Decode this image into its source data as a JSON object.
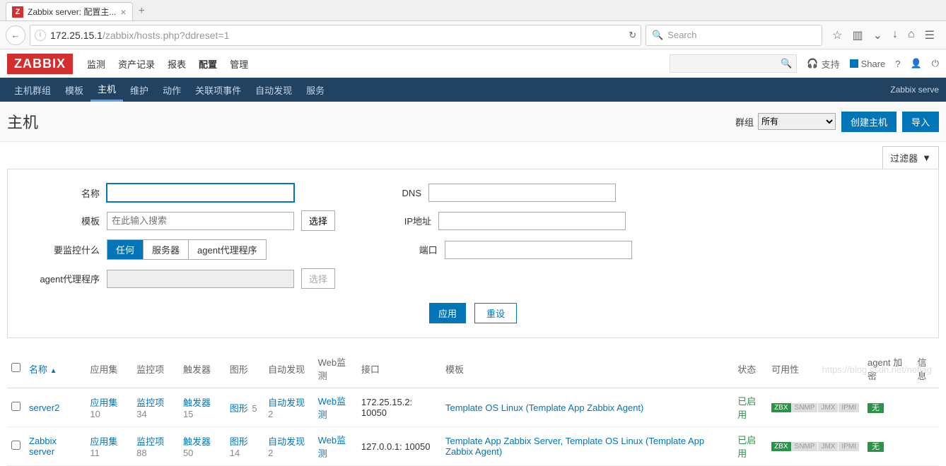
{
  "browser": {
    "tab_title": "Zabbix server: 配置主...",
    "favicon_letter": "Z",
    "url_host": "172.25.15.1",
    "url_path": "/zabbix/hosts.php?ddreset=1",
    "search_placeholder": "Search"
  },
  "header": {
    "logo": "ZABBIX",
    "nav": [
      "监测",
      "资产记录",
      "报表",
      "配置",
      "管理"
    ],
    "nav_active": "配置",
    "support": "支持",
    "share": "Share"
  },
  "subnav": {
    "items": [
      "主机群组",
      "模板",
      "主机",
      "维护",
      "动作",
      "关联项事件",
      "自动发现",
      "服务"
    ],
    "active": "主机",
    "right": "Zabbix serve"
  },
  "page": {
    "title": "主机",
    "group_label": "群组",
    "group_value": "所有",
    "create_btn": "创建主机",
    "import_btn": "导入"
  },
  "filter": {
    "tab_label": "过滤器",
    "name_label": "名称",
    "template_label": "模板",
    "template_placeholder": "在此输入搜索",
    "select_btn": "选择",
    "monitor_label": "要监控什么",
    "monitor_options": [
      "任何",
      "服务器",
      "agent代理程序"
    ],
    "agent_label": "agent代理程序",
    "dns_label": "DNS",
    "ip_label": "IP地址",
    "port_label": "端口",
    "apply_btn": "应用",
    "reset_btn": "重设"
  },
  "table": {
    "columns": [
      "名称",
      "应用集",
      "监控项",
      "触发器",
      "图形",
      "自动发现",
      "Web监测",
      "接口",
      "模板",
      "状态",
      "可用性",
      "agent 加密",
      "信息"
    ],
    "sort_col": "名称",
    "rows": [
      {
        "name": "server2",
        "app_count": 10,
        "app_label": "应用集",
        "item_count": 34,
        "item_label": "监控项",
        "trig_count": 15,
        "trig_label": "触发器",
        "graph_count": 5,
        "graph_label": "图形",
        "disc_count": 2,
        "disc_label": "自动发现",
        "web_label": "Web监测",
        "interface": "172.25.15.2: 10050",
        "templates": "Template OS Linux (Template App Zabbix Agent)",
        "status": "已启用",
        "avail": [
          "ZBX",
          "SNMP",
          "JMX",
          "IPMI"
        ],
        "encryption": "无"
      },
      {
        "name": "Zabbix server",
        "app_count": 11,
        "app_label": "应用集",
        "item_count": 88,
        "item_label": "监控项",
        "trig_count": 50,
        "trig_label": "触发器",
        "graph_count": 14,
        "graph_label": "图形",
        "disc_count": 2,
        "disc_label": "自动发现",
        "web_label": "Web监测",
        "interface": "127.0.0.1: 10050",
        "templates": "Template App Zabbix Server, Template OS Linux (Template App Zabbix Agent)",
        "status": "已启用",
        "avail": [
          "ZBX",
          "SNMP",
          "JMX",
          "IPMI"
        ],
        "encryption": "无"
      }
    ]
  },
  "watermark": "https://blog.csdn.net/noflag"
}
